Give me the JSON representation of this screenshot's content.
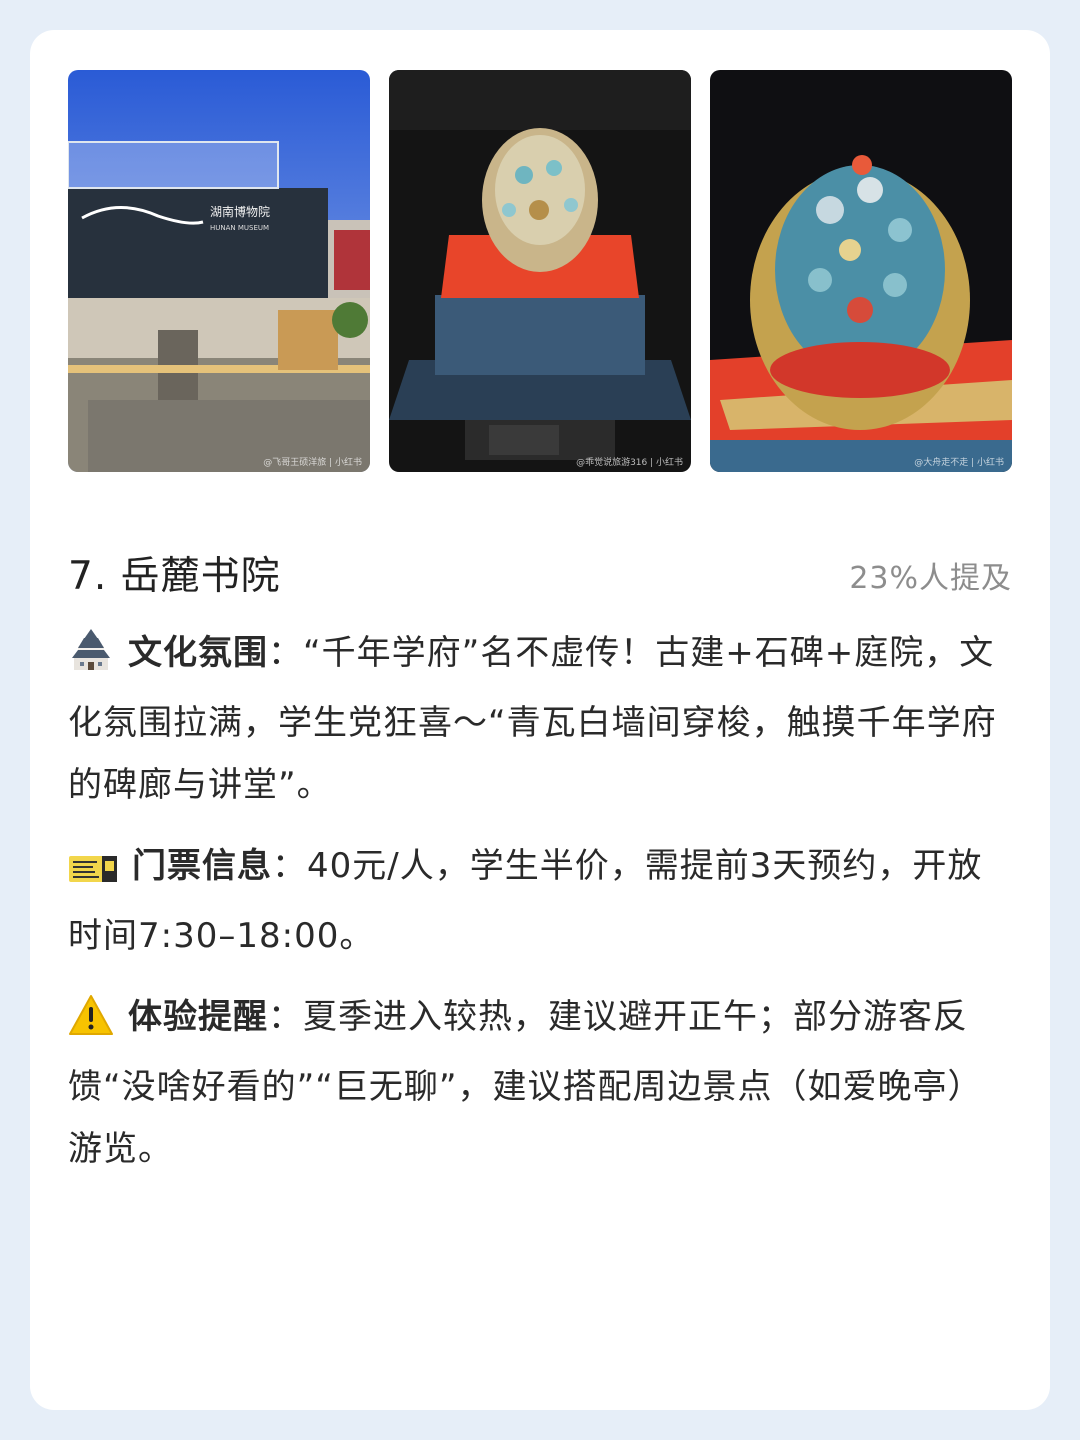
{
  "photos": [
    {
      "caption": "湖南博物院",
      "caption_en": "HUNAN MUSEUM",
      "watermark": "@飞哥王硕洋旅 | 小红书"
    },
    {
      "caption": "",
      "watermark": "@乖觉说旅游316 | 小红书"
    },
    {
      "caption": "",
      "watermark": "@大舟走不走 | 小红书"
    }
  ],
  "title": "7. 岳麓书院",
  "mention": "23%人提及",
  "sections": [
    {
      "icon": "castle-icon",
      "label": "文化氛围",
      "sep": "：",
      "text": "“千年学府”名不虚传！古建+石碑+庭院，文化氛围拉满，学生党狂喜～“青瓦白墙间穿梭，触摸千年学府的碑廊与讲堂”。"
    },
    {
      "icon": "ticket-icon",
      "label": "门票信息",
      "sep": "：",
      "text": "40元/人，学生半价，需提前3天预约，开放时间7:30–18:00。"
    },
    {
      "icon": "warning-icon",
      "label": "体验提醒",
      "sep": "：",
      "text": "夏季进入较热，建议避开正午；部分游客反馈“没啥好看的”“巨无聊”，建议搭配周边景点（如爱晚亭）游览。"
    }
  ]
}
